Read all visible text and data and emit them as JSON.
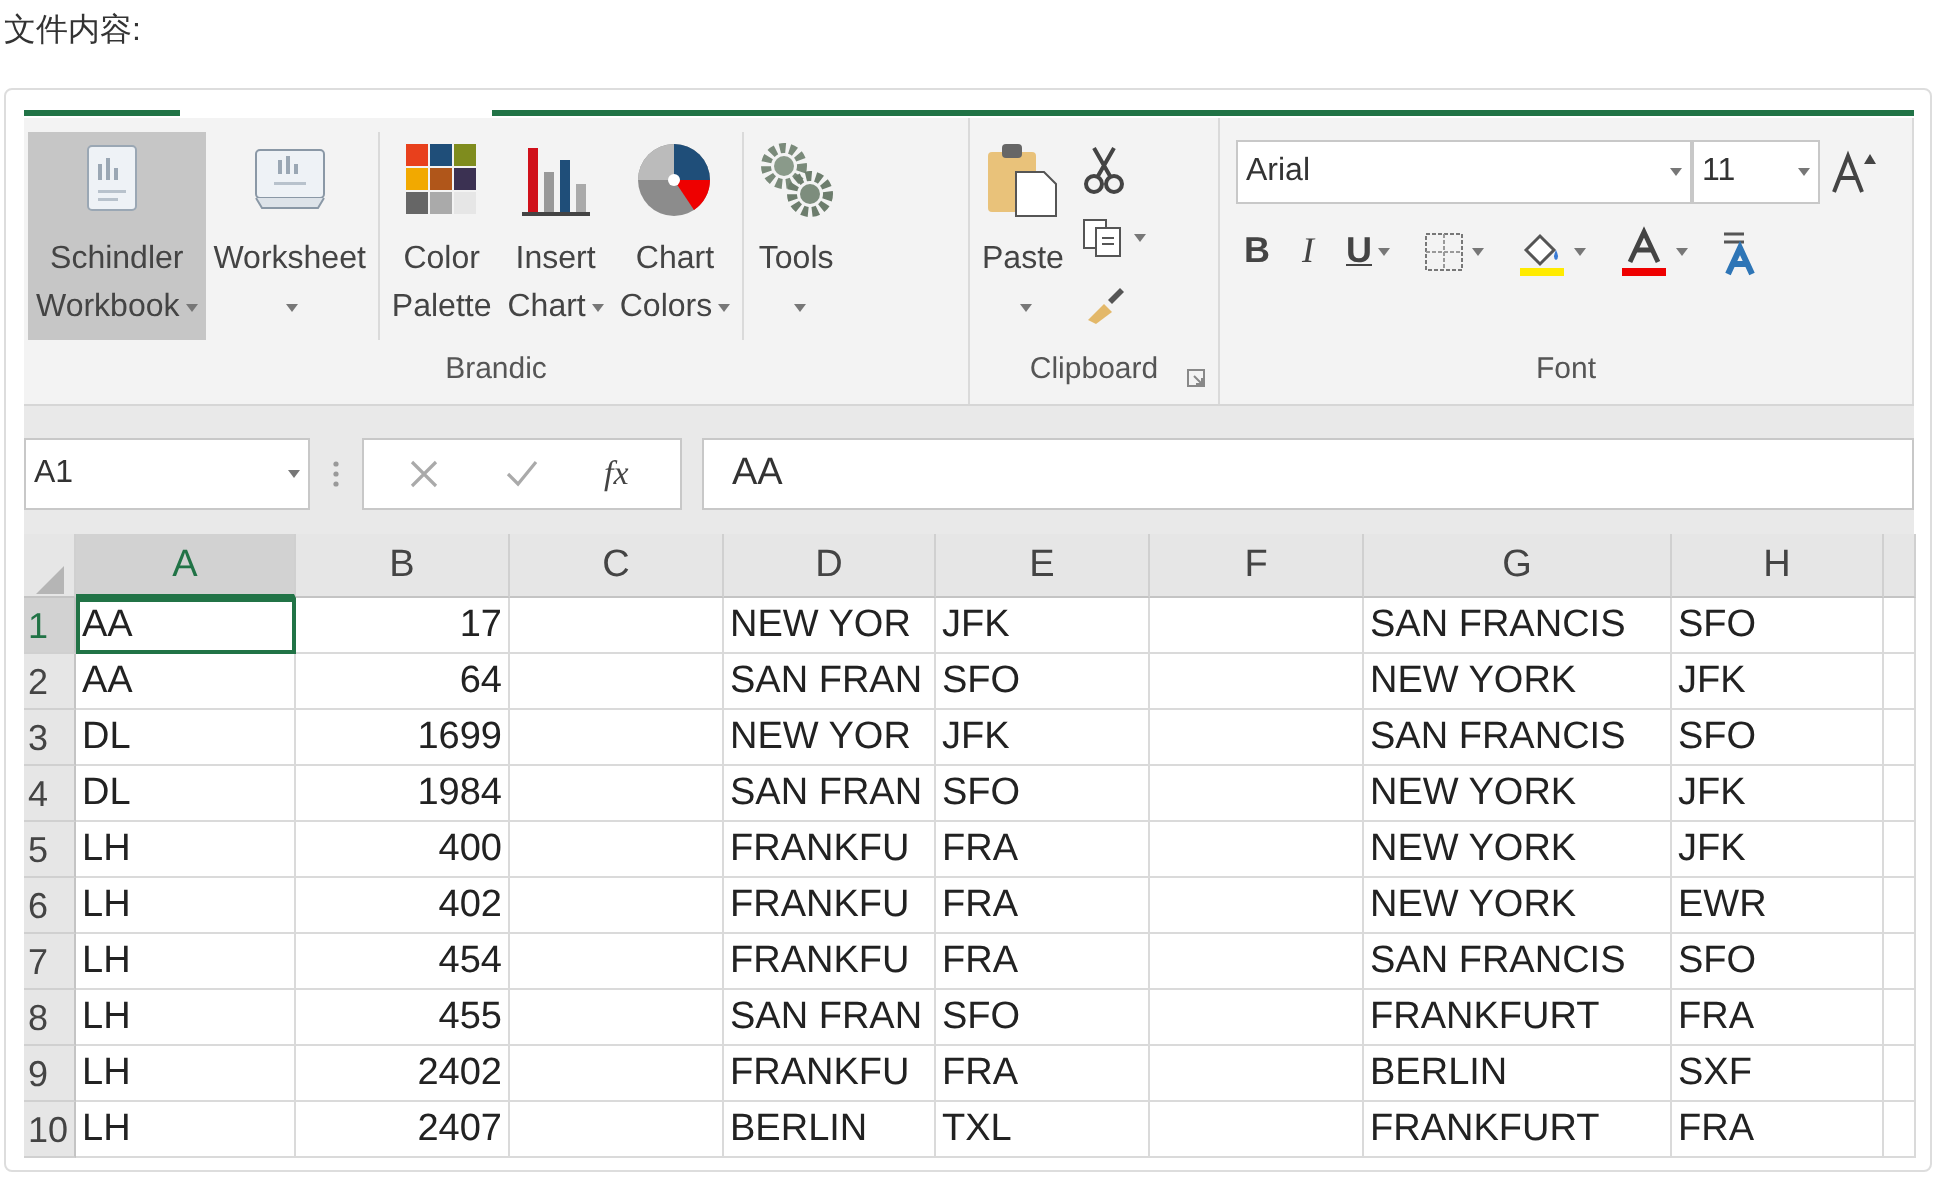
{
  "page_label": "文件内容:",
  "ribbon": {
    "groups": [
      {
        "title": "Brandic",
        "launcher": false,
        "sections": [
          [
            {
              "lines": [
                "Schindler",
                "Workbook"
              ],
              "dropdown": true,
              "selected": true
            },
            {
              "lines": [
                "Worksheet"
              ],
              "dropdown": true,
              "selected": false
            }
          ],
          [
            {
              "lines": [
                "Color",
                "Palette"
              ],
              "dropdown": false,
              "selected": false
            },
            {
              "lines": [
                "Insert",
                "Chart"
              ],
              "dropdown": true,
              "selected": false
            },
            {
              "lines": [
                "Chart",
                "Colors"
              ],
              "dropdown": true,
              "selected": false
            }
          ],
          [
            {
              "lines": [
                "Tools"
              ],
              "dropdown": true,
              "selected": false
            }
          ]
        ]
      },
      {
        "title": "Clipboard",
        "launcher": true,
        "sections": [
          [
            {
              "lines": [
                "Paste"
              ],
              "dropdown": true,
              "selected": false
            }
          ]
        ]
      },
      {
        "title": "Font",
        "launcher": false
      }
    ]
  },
  "font": {
    "name": "Arial",
    "size": "11",
    "styles": [
      "B",
      "I",
      "U"
    ]
  },
  "formula_bar": {
    "name_box": "A1",
    "function_label": "fx",
    "formula": "AA"
  },
  "sheet": {
    "columns": [
      {
        "label": "A",
        "kind": "text",
        "selected": true
      },
      {
        "label": "B",
        "kind": "number",
        "selected": false
      },
      {
        "label": "C",
        "kind": "text",
        "selected": false
      },
      {
        "label": "D",
        "kind": "text",
        "selected": false
      },
      {
        "label": "E",
        "kind": "text",
        "selected": false
      },
      {
        "label": "F",
        "kind": "text",
        "selected": false
      },
      {
        "label": "G",
        "kind": "text",
        "selected": false
      },
      {
        "label": "H",
        "kind": "text",
        "selected": false
      }
    ],
    "rows": [
      {
        "number": "1",
        "selected": true,
        "cells": [
          "AA",
          "17",
          "",
          "NEW YOR",
          "JFK",
          "",
          "SAN FRANCIS",
          "SFO"
        ]
      },
      {
        "number": "2",
        "selected": false,
        "cells": [
          "AA",
          "64",
          "",
          "SAN FRAN",
          "SFO",
          "",
          "NEW YORK",
          "JFK"
        ]
      },
      {
        "number": "3",
        "selected": false,
        "cells": [
          "DL",
          "1699",
          "",
          "NEW YOR",
          "JFK",
          "",
          "SAN FRANCIS",
          "SFO"
        ]
      },
      {
        "number": "4",
        "selected": false,
        "cells": [
          "DL",
          "1984",
          "",
          "SAN FRAN",
          "SFO",
          "",
          "NEW YORK",
          "JFK"
        ]
      },
      {
        "number": "5",
        "selected": false,
        "cells": [
          "LH",
          "400",
          "",
          "FRANKFU",
          "FRA",
          "",
          "NEW YORK",
          "JFK"
        ]
      },
      {
        "number": "6",
        "selected": false,
        "cells": [
          "LH",
          "402",
          "",
          "FRANKFU",
          "FRA",
          "",
          "NEW YORK",
          "EWR"
        ]
      },
      {
        "number": "7",
        "selected": false,
        "cells": [
          "LH",
          "454",
          "",
          "FRANKFU",
          "FRA",
          "",
          "SAN FRANCIS",
          "SFO"
        ]
      },
      {
        "number": "8",
        "selected": false,
        "cells": [
          "LH",
          "455",
          "",
          "SAN FRAN",
          "SFO",
          "",
          "FRANKFURT",
          "FRA"
        ]
      },
      {
        "number": "9",
        "selected": false,
        "cells": [
          "LH",
          "2402",
          "",
          "FRANKFU",
          "FRA",
          "",
          "BERLIN",
          "SXF"
        ]
      },
      {
        "number": "10",
        "selected": false,
        "cells": [
          "LH",
          "2407",
          "",
          "BERLIN",
          "TXL",
          "",
          "FRANKFURT",
          "FRA"
        ]
      }
    ]
  }
}
